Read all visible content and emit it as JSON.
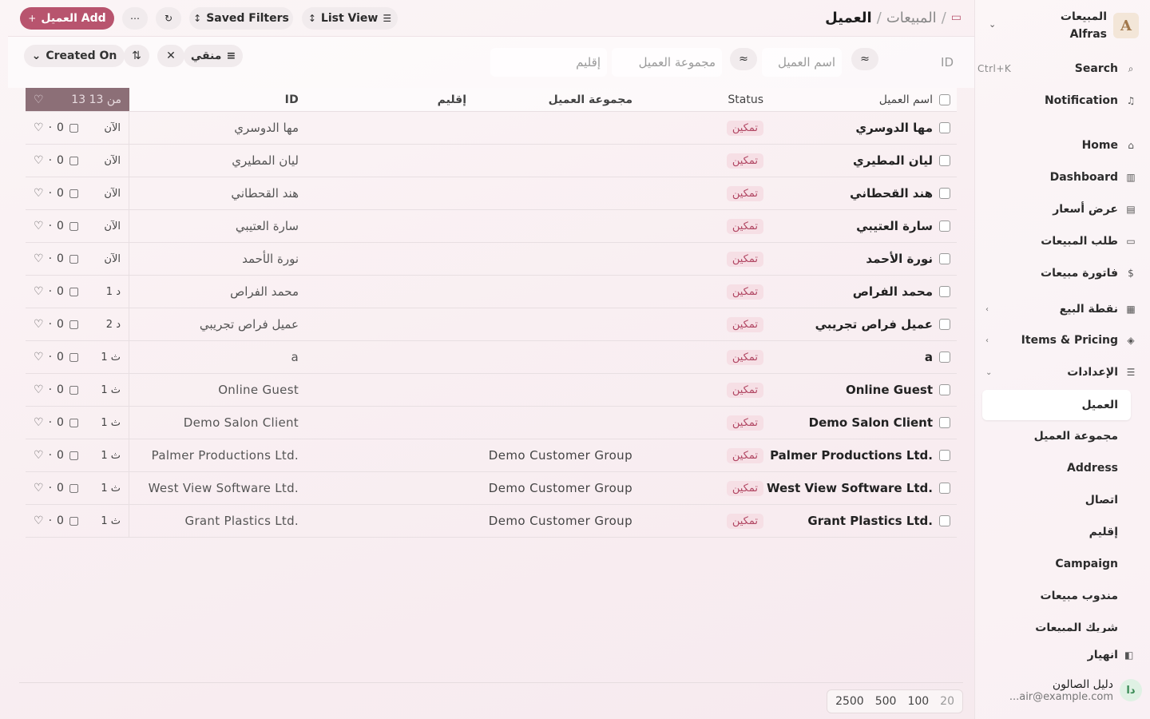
{
  "sidebar": {
    "brand_line1": "المبيعات",
    "brand_line2": "Alfras",
    "brand_logo": "A",
    "search_label": "Search",
    "search_shortcut": "Ctrl+K",
    "notification_label": "Notification",
    "items": [
      {
        "label": "Home",
        "icon": "home-icon"
      },
      {
        "label": "Dashboard",
        "icon": "chart-icon"
      },
      {
        "label": "عرض أسعار",
        "icon": "document-icon"
      },
      {
        "label": "طلب المبيعات",
        "icon": "card-icon"
      },
      {
        "label": "فاتورة مبيعات",
        "icon": "invoice-icon"
      },
      {
        "label": "نقطة البيع",
        "icon": "register-icon"
      },
      {
        "label": "Items & Pricing",
        "icon": "box-icon"
      },
      {
        "label": "الإعدادات",
        "icon": "database-icon"
      }
    ],
    "sub_items": [
      "العميل",
      "مجموعة العميل",
      "Address",
      "اتصال",
      "إقليم",
      "Campaign",
      "مندوب مبيعات",
      "شريك المبيعات"
    ],
    "collapse_label": "انهيار",
    "user": {
      "name": "دليل الصالون",
      "email": "...air@example.com",
      "initials": "دا"
    }
  },
  "topbar": {
    "breadcrumb_parent": "المبيعات",
    "breadcrumb_current": "العميل",
    "add_button": "العميل Add",
    "list_view": "List View",
    "saved_filters": "Saved Filters"
  },
  "filters": {
    "id_placeholder": "ID",
    "customer_name_placeholder": "اسم العميل",
    "customer_group_placeholder": "مجموعة العميل",
    "territory_placeholder": "إقليم",
    "filter_label": "منقي",
    "sort_label": "Created On"
  },
  "table": {
    "headers": {
      "name": "اسم العميل",
      "status": "Status",
      "group": "مجموعة العميل",
      "territory": "إقليم",
      "id": "ID",
      "count": "13 من 13"
    },
    "rows": [
      {
        "name": "مها الدوسري",
        "status": "تمكين",
        "group": "",
        "id": "مها الدوسري",
        "time": "الآن",
        "comments": "0"
      },
      {
        "name": "ليان المطيري",
        "status": "تمكين",
        "group": "",
        "id": "ليان المطيري",
        "time": "الآن",
        "comments": "0"
      },
      {
        "name": "هند القحطاني",
        "status": "تمكين",
        "group": "",
        "id": "هند القحطاني",
        "time": "الآن",
        "comments": "0"
      },
      {
        "name": "سارة العتيبي",
        "status": "تمكين",
        "group": "",
        "id": "سارة العتيبي",
        "time": "الآن",
        "comments": "0"
      },
      {
        "name": "نورة الأحمد",
        "status": "تمكين",
        "group": "",
        "id": "نورة الأحمد",
        "time": "الآن",
        "comments": "0"
      },
      {
        "name": "محمد الفراص",
        "status": "تمكين",
        "group": "",
        "id": "محمد الفراص",
        "time": "1 د",
        "comments": "0"
      },
      {
        "name": "عميل فراص تجريبي",
        "status": "تمكين",
        "group": "",
        "id": "عميل فراص تجريبي",
        "time": "2 د",
        "comments": "0"
      },
      {
        "name": "a",
        "status": "تمكين",
        "group": "",
        "id": "a",
        "time": "1 ث",
        "comments": "0"
      },
      {
        "name": "Online Guest",
        "status": "تمكين",
        "group": "",
        "id": "Online Guest",
        "time": "1 ث",
        "comments": "0"
      },
      {
        "name": "Demo Salon Client",
        "status": "تمكين",
        "group": "",
        "id": "Demo Salon Client",
        "time": "1 ث",
        "comments": "0"
      },
      {
        "name": "Palmer Productions Ltd.",
        "status": "تمكين",
        "group": "Demo Customer Group",
        "id": "Palmer Productions Ltd.",
        "time": "1 ث",
        "comments": "0"
      },
      {
        "name": "West View Software Ltd.",
        "status": "تمكين",
        "group": "Demo Customer Group",
        "id": "West View Software Ltd.",
        "time": "1 ث",
        "comments": "0"
      },
      {
        "name": "Grant Plastics Ltd.",
        "status": "تمكين",
        "group": "Demo Customer Group",
        "id": "Grant Plastics Ltd.",
        "time": "1 ث",
        "comments": "0"
      }
    ]
  },
  "pagination": {
    "sizes": [
      "20",
      "100",
      "500",
      "2500"
    ]
  },
  "colors": {
    "accent": "#b8546e",
    "badge_bg": "#f6dfe5",
    "badge_fg": "#b14763"
  }
}
